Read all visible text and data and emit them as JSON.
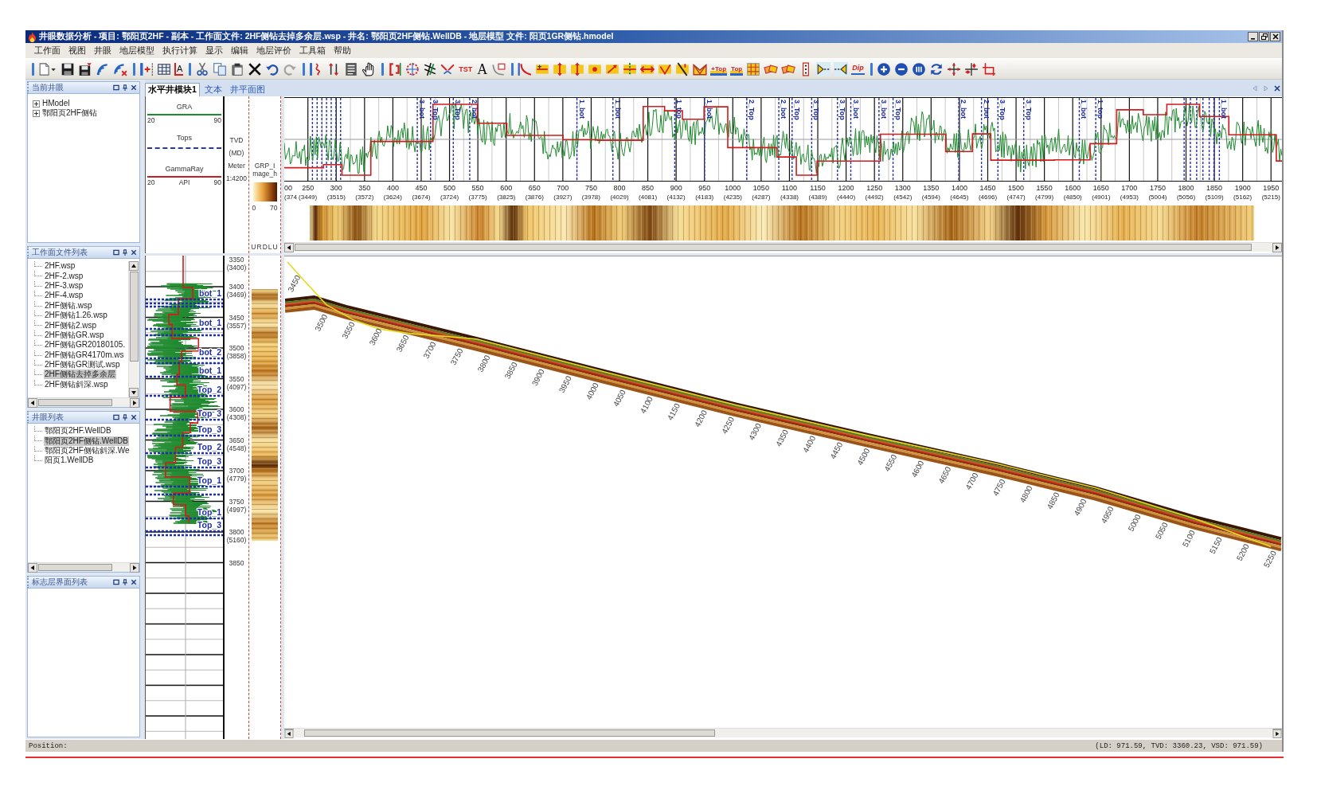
{
  "window": {
    "title": "井眼数据分析 - 项目: 鄂阳页2HF - 副本 - 工作面文件: 2HF侧钻去掉多余层.wsp - 井名: 鄂阳页2HF侧钻.WellDB - 地层模型 文件: 阳页1GR侧钻.hmodel"
  },
  "menu": [
    "工作面",
    "视图",
    "井眼",
    "地层模型",
    "执行计算",
    "显示",
    "编辑",
    "地层评价",
    "工具箱",
    "帮助"
  ],
  "toolbar": [
    [
      {
        "kind": "new-file",
        "disabled": false
      },
      {
        "kind": "save",
        "disabled": false
      },
      {
        "kind": "save-as",
        "disabled": false
      },
      {
        "kind": "signal",
        "disabled": false
      },
      {
        "kind": "signal-red",
        "disabled": false
      }
    ],
    [
      {
        "kind": "track-insert",
        "disabled": false
      },
      {
        "kind": "grid",
        "disabled": false
      },
      {
        "kind": "letter-corner",
        "label": "A",
        "disabled": false
      }
    ],
    [
      {
        "kind": "cut",
        "disabled": false
      },
      {
        "kind": "copy",
        "disabled": false
      },
      {
        "kind": "paste",
        "disabled": false
      },
      {
        "kind": "delete",
        "disabled": false
      },
      {
        "kind": "undo",
        "disabled": false
      },
      {
        "kind": "redo",
        "disabled": true
      }
    ],
    [
      {
        "kind": "curve-bracket",
        "disabled": false
      },
      {
        "kind": "arrows-vertical",
        "disabled": false
      },
      {
        "kind": "log-list",
        "disabled": false
      },
      {
        "kind": "hand",
        "disabled": false
      }
    ],
    [
      {
        "kind": "bracket",
        "disabled": false
      },
      {
        "kind": "dotted-circle",
        "disabled": false
      },
      {
        "kind": "cross-lines",
        "disabled": false
      },
      {
        "kind": "join-arrows",
        "disabled": false
      },
      {
        "kind": "red-label",
        "label": "TST",
        "disabled": false
      },
      {
        "kind": "letter",
        "label": "A",
        "disabled": false
      },
      {
        "kind": "curve-note",
        "disabled": false
      }
    ],
    [
      {
        "kind": "curve",
        "disabled": false
      },
      {
        "kind": "tile-plus",
        "disabled": false
      },
      {
        "kind": "tile-updown",
        "disabled": false
      },
      {
        "kind": "tile-updown",
        "disabled": false
      },
      {
        "kind": "tile-dot",
        "disabled": false
      },
      {
        "kind": "tile-arrow",
        "disabled": false
      },
      {
        "kind": "tile-split",
        "disabled": false
      },
      {
        "kind": "tile-double",
        "disabled": false
      },
      {
        "kind": "tile-check",
        "disabled": false
      },
      {
        "kind": "tile-slash",
        "disabled": false
      },
      {
        "kind": "fold",
        "disabled": false
      },
      {
        "kind": "top-label",
        "label": "+Top",
        "disabled": false
      },
      {
        "kind": "top-label",
        "label": "Top",
        "disabled": false
      },
      {
        "kind": "tile-grid",
        "disabled": false
      },
      {
        "kind": "tiles",
        "disabled": false
      },
      {
        "kind": "tiles",
        "disabled": false
      },
      {
        "kind": "dotted-bar",
        "disabled": false
      },
      {
        "kind": "arrow-right",
        "disabled": false
      },
      {
        "kind": "arrow-left",
        "disabled": false
      },
      {
        "kind": "dip-label",
        "label": "Dip",
        "disabled": false
      }
    ],
    [
      {
        "kind": "zoom-in",
        "disabled": false
      },
      {
        "kind": "zoom-out",
        "disabled": false
      },
      {
        "kind": "zoom-fit",
        "disabled": false
      },
      {
        "kind": "refresh",
        "disabled": false
      },
      {
        "kind": "crosshair",
        "disabled": false
      },
      {
        "kind": "split",
        "disabled": false
      },
      {
        "kind": "corner",
        "disabled": false
      }
    ]
  ],
  "panels": [
    {
      "title": "当前井眼",
      "kind": "tree",
      "items": [
        {
          "label": "HModel",
          "expanded": false
        },
        {
          "label": "鄂阳页2HF侧钻",
          "expanded": false
        }
      ]
    },
    {
      "title": "工作面文件列表",
      "kind": "file-list",
      "items": [
        {
          "label": "2HF.wsp",
          "selected": false
        },
        {
          "label": "2HF-2.wsp",
          "selected": false
        },
        {
          "label": "2HF-3.wsp",
          "selected": false
        },
        {
          "label": "2HF-4.wsp",
          "selected": false
        },
        {
          "label": "2HF侧钻.wsp",
          "selected": false
        },
        {
          "label": "2HF侧钻1.26.wsp",
          "selected": false
        },
        {
          "label": "2HF侧钻2.wsp",
          "selected": false
        },
        {
          "label": "2HF侧钻GR.wsp",
          "selected": false
        },
        {
          "label": "2HF侧钻GR20180105.",
          "selected": false
        },
        {
          "label": "2HF侧钻GR4170m.ws",
          "selected": false
        },
        {
          "label": "2HF侧钻GR测试.wsp",
          "selected": false
        },
        {
          "label": "2HF侧钻去掉多余层",
          "selected": true
        },
        {
          "label": "2HF侧钻斜深.wsp",
          "selected": false
        }
      ]
    },
    {
      "title": "井眼列表",
      "kind": "well-list",
      "items": [
        {
          "label": "鄂阳页2HF.WellDB",
          "selected": false
        },
        {
          "label": "鄂阳页2HF侧钻.WellDB",
          "selected": true
        },
        {
          "label": "鄂阳页2HF侧钻斜深.We",
          "selected": false
        },
        {
          "label": "阳页1.WellDB",
          "selected": false
        }
      ]
    },
    {
      "title": "标志层界面列表",
      "kind": "empty"
    }
  ],
  "tabs": [
    {
      "label": "水平井模块1",
      "selected": true
    },
    {
      "label": "文本",
      "selected": false
    },
    {
      "label": "井平面图",
      "selected": false
    }
  ],
  "track_header": {
    "curve_1": {
      "name": "GRA",
      "min": "20",
      "max": "90"
    },
    "tops": {
      "name": "Tops"
    },
    "curve_2": {
      "name": "GammaRay",
      "min": "20",
      "unit": "API",
      "max": "90"
    }
  },
  "depth_header": [
    "TVD",
    "(MD)",
    "Meter",
    "1:4200"
  ],
  "image_header": {
    "name": "GRP_Image_h",
    "min": "0",
    "max": "70",
    "footer": "URDLU"
  },
  "top_markers": [
    "3_bot",
    "3_Top",
    "3_Top",
    "2_bot",
    "1_bot",
    "1_bot",
    "1_top",
    "1_bot",
    "2_Top",
    "2_bot",
    "3_Top",
    "3_Top",
    "3_Top",
    "3_bot",
    "3_bot",
    "3_Top",
    "2_bot",
    "2_bot",
    "3_Top",
    "3_Top",
    "1_bot",
    "1_top",
    "1_bot"
  ],
  "top_axis": [
    {
      "label": "00",
      "paren_label": "(374"
    },
    {
      "label": "250",
      "paren_label": "(3449)"
    },
    {
      "label": "300",
      "paren_label": "(3515)"
    },
    {
      "label": "350",
      "paren_label": "(3572)"
    },
    {
      "label": "400",
      "paren_label": "(3624)"
    },
    {
      "label": "450",
      "paren_label": "(3674)"
    },
    {
      "label": "500",
      "paren_label": "(3724)"
    },
    {
      "label": "550",
      "paren_label": "(3775)"
    },
    {
      "label": "600",
      "paren_label": "(3825)"
    },
    {
      "label": "650",
      "paren_label": "(3876)"
    },
    {
      "label": "700",
      "paren_label": "(3927)"
    },
    {
      "label": "750",
      "paren_label": "(3978)"
    },
    {
      "label": "800",
      "paren_label": "(4029)"
    },
    {
      "label": "850",
      "paren_label": "(4081)"
    },
    {
      "label": "900",
      "paren_label": "(4132)"
    },
    {
      "label": "950",
      "paren_label": "(4183)"
    },
    {
      "label": "1000",
      "paren_label": "(4235)"
    },
    {
      "label": "1050",
      "paren_label": "(4287)"
    },
    {
      "label": "1100",
      "paren_label": "(4338)"
    },
    {
      "label": "1150",
      "paren_label": "(4389)"
    },
    {
      "label": "1200",
      "paren_label": "(4440)"
    },
    {
      "label": "1250",
      "paren_label": "(4492)"
    },
    {
      "label": "1300",
      "paren_label": "(4542)"
    },
    {
      "label": "1350",
      "paren_label": "(4594)"
    },
    {
      "label": "1400",
      "paren_label": "(4645)"
    },
    {
      "label": "1450",
      "paren_label": "(4696)"
    },
    {
      "label": "1500",
      "paren_label": "(4747)"
    },
    {
      "label": "1550",
      "paren_label": "(4799)"
    },
    {
      "label": "1600",
      "paren_label": "(4850)"
    },
    {
      "label": "1650",
      "paren_label": "(4901)"
    },
    {
      "label": "1700",
      "paren_label": "(4953)"
    },
    {
      "label": "1750",
      "paren_label": "(5004)"
    },
    {
      "label": "1800",
      "paren_label": "(5056)"
    },
    {
      "label": "1850",
      "paren_label": "(5109)"
    },
    {
      "label": "1900",
      "paren_label": "(5162)"
    },
    {
      "label": "1950",
      "paren_label": "(5215)"
    }
  ],
  "track_markers": [
    "bot_1",
    "bot_1",
    "bot_2",
    "bot_1",
    "Top_2",
    "Top_3",
    "Top_3",
    "Top_2",
    "Top_3",
    "Top_1",
    "Top_1",
    "Top_3"
  ],
  "depth_scale": [
    {
      "tvd": "3350",
      "md": "(3400)"
    },
    {
      "tvd": "3400",
      "md": "(3469)"
    },
    {
      "tvd": "3450",
      "md": "(3557)"
    },
    {
      "tvd": "3500",
      "md": "(3858)"
    },
    {
      "tvd": "3550",
      "md": "(4097)"
    },
    {
      "tvd": "3600",
      "md": "(4308)"
    },
    {
      "tvd": "3650",
      "md": "(4548)"
    },
    {
      "tvd": "3700",
      "md": "(4779)"
    },
    {
      "tvd": "3750",
      "md": "(4997)"
    },
    {
      "tvd": "3800",
      "md": "(5160)"
    },
    {
      "tvd": "3850"
    }
  ],
  "well_depth_labels": [
    "3450",
    "3500",
    "3550",
    "3600",
    "3650",
    "3700",
    "3750",
    "3800",
    "3850",
    "3900",
    "3950",
    "4000",
    "4050",
    "4100",
    "4150",
    "4200",
    "4250",
    "4300",
    "4350",
    "4400",
    "4450",
    "4500",
    "4550",
    "4600",
    "4650",
    "4700",
    "4750",
    "4800",
    "4850",
    "4900",
    "4950",
    "5000",
    "5050",
    "5100",
    "5150",
    "5200",
    "5250"
  ],
  "status_bar": {
    "left": "Position:",
    "right": "(LD: 971.59, TVD: 3360.23, VSD: 971.59)"
  }
}
